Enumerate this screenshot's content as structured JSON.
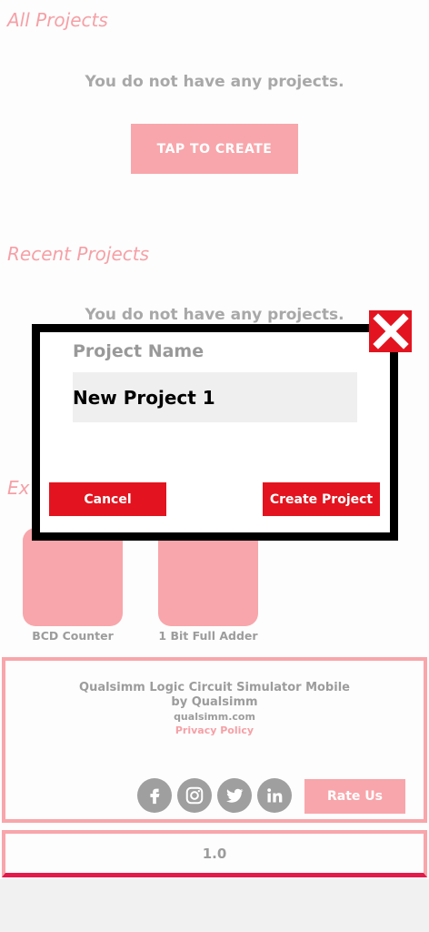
{
  "all_projects": {
    "title": "All Projects",
    "empty_message": "You do not have any projects.",
    "create_label": "TAP TO CREATE"
  },
  "recent_projects": {
    "title": "Recent Projects",
    "empty_message": "You do not have any projects."
  },
  "examples": {
    "title_visible": "Ex",
    "items": [
      {
        "label": "BCD Counter"
      },
      {
        "label": "1 Bit Full Adder"
      }
    ]
  },
  "footer": {
    "app_name": "Qualsimm Logic Circuit Simulator Mobile",
    "by_line": "by Qualsimm",
    "website": "qualsimm.com",
    "privacy": "Privacy Policy",
    "rate_label": "Rate Us",
    "social": [
      "facebook-icon",
      "instagram-icon",
      "twitter-icon",
      "linkedin-icon"
    ]
  },
  "version": "1.0",
  "modal": {
    "label": "Project Name",
    "project_name_value": "New Project 1",
    "cancel_label": "Cancel",
    "create_label": "Create Project"
  },
  "colors": {
    "accent_pink": "#f8a6ab",
    "primary_red": "#e3141f",
    "text_gray": "#9c9c9c"
  }
}
